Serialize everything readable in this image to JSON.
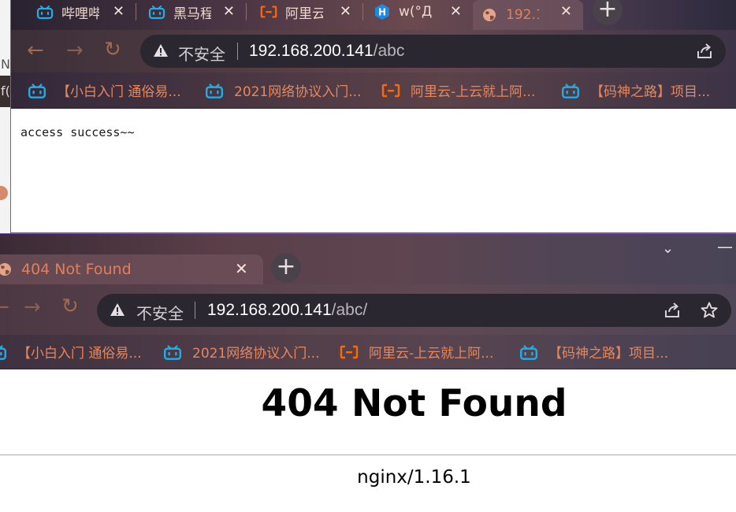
{
  "background_window": {
    "fragments": [
      "N",
      "f("
    ]
  },
  "window1": {
    "tabs": [
      {
        "title": "哔哩哔",
        "icon": "bilibili-icon"
      },
      {
        "title": "黑马程",
        "icon": "bilibili-icon"
      },
      {
        "title": "阿里云",
        "icon": "aliyun-icon"
      },
      {
        "title": "w(°Д",
        "icon": "h-hexagon-icon"
      },
      {
        "title": "192.1",
        "icon": "globe-icon",
        "active": true
      }
    ],
    "address": {
      "insecure_label": "不安全",
      "host": "192.168.200.141",
      "path": "/abc"
    },
    "bookmarks": [
      {
        "label": "【小白入门 通俗易...",
        "icon": "bilibili-icon"
      },
      {
        "label": "2021网络协议入门...",
        "icon": "bilibili-icon"
      },
      {
        "label": "阿里云-上云就上阿...",
        "icon": "aliyun-icon"
      },
      {
        "label": "【码神之路】项目...",
        "icon": "bilibili-icon"
      }
    ],
    "page_text": "access success~~"
  },
  "window2": {
    "tab_title": "404 Not Found",
    "address": {
      "insecure_label": "不安全",
      "host": "192.168.200.141",
      "path": "/abc/"
    },
    "bookmarks": [
      {
        "label": "【小白入门 通俗易...",
        "icon": "bilibili-icon"
      },
      {
        "label": "2021网络协议入门...",
        "icon": "bilibili-icon"
      },
      {
        "label": "阿里云-上云就上阿...",
        "icon": "aliyun-icon"
      },
      {
        "label": "【码神之路】项目...",
        "icon": "bilibili-icon"
      }
    ],
    "heading": "404 Not Found",
    "footer": "nginx/1.16.1"
  },
  "colors": {
    "accent_orange": "#e6875e",
    "bilibili_blue": "#23ade5",
    "aliyun_orange": "#ff6a00",
    "window_border": "#7b56b8"
  }
}
